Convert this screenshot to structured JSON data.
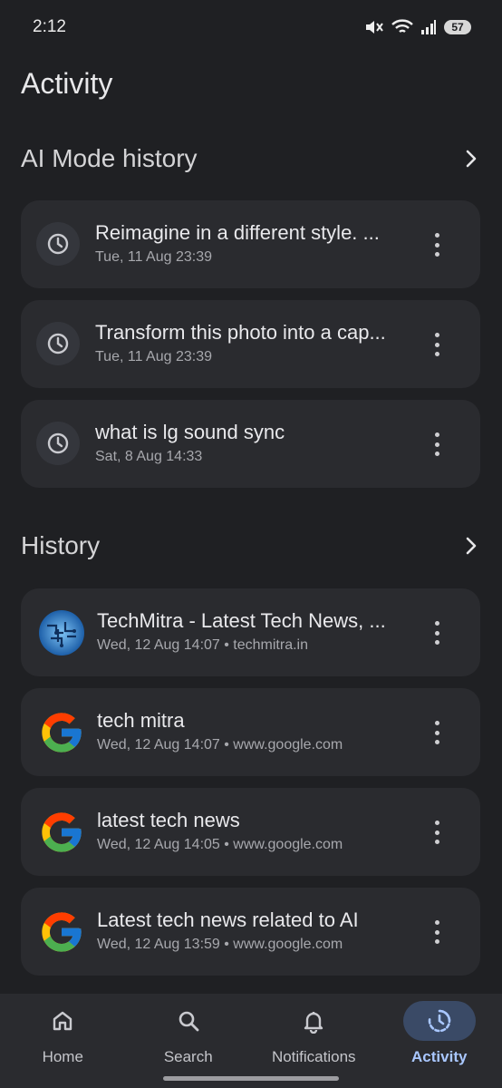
{
  "status_bar": {
    "time": "2:12",
    "battery": "57",
    "icons": [
      "mute-icon",
      "wifi-icon",
      "signal-icon",
      "battery-icon"
    ]
  },
  "page": {
    "title": "Activity"
  },
  "ai_mode": {
    "title": "AI Mode history",
    "items": [
      {
        "title": "Reimagine in a different style. ...",
        "subtitle": "Tue, 11 Aug 23:39",
        "icon": "history-clock-icon"
      },
      {
        "title": "Transform this photo into a cap...",
        "subtitle": "Tue, 11 Aug 23:39",
        "icon": "history-clock-icon"
      },
      {
        "title": "what is lg sound sync",
        "subtitle": "Sat, 8 Aug 14:33",
        "icon": "history-clock-icon"
      }
    ]
  },
  "history": {
    "title": "History",
    "items": [
      {
        "title": "TechMitra - Latest Tech News, ...",
        "subtitle": "Wed, 12 Aug 14:07 • techmitra.in",
        "icon": "techmitra-favicon"
      },
      {
        "title": "tech mitra",
        "subtitle": "Wed, 12 Aug 14:07 • www.google.com",
        "icon": "google-g-icon"
      },
      {
        "title": "latest tech news",
        "subtitle": "Wed, 12 Aug 14:05 • www.google.com",
        "icon": "google-g-icon"
      },
      {
        "title": "Latest tech news related to AI",
        "subtitle": "Wed, 12 Aug 13:59 • www.google.com",
        "icon": "google-g-icon"
      }
    ]
  },
  "nav": {
    "items": [
      {
        "label": "Home",
        "icon": "home-icon",
        "active": false
      },
      {
        "label": "Search",
        "icon": "search-icon",
        "active": false
      },
      {
        "label": "Notifications",
        "icon": "bell-icon",
        "active": false
      },
      {
        "label": "Activity",
        "icon": "activity-icon",
        "active": true
      }
    ]
  },
  "colors": {
    "background": "#1f2023",
    "card": "#2a2b2f",
    "active_accent": "#a9c7ff",
    "active_pill": "#3a4a66"
  }
}
